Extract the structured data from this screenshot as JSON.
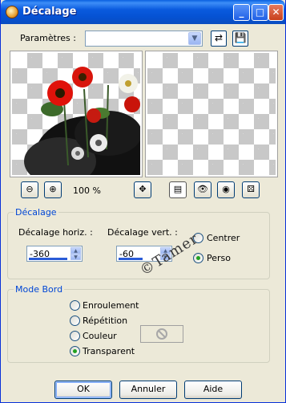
{
  "window": {
    "title": "Décalage"
  },
  "presets": {
    "label": "Paramètres :",
    "value": ""
  },
  "zoom": {
    "level_text": "100 %"
  },
  "offset_group": {
    "title": "Décalage",
    "horiz_label": "Décalage horiz. :",
    "horiz_value": "-360",
    "vert_label": "Décalage vert. :",
    "vert_value": "-60",
    "option_center": "Centrer",
    "option_custom": "Perso",
    "selected": "Perso"
  },
  "edge_group": {
    "title": "Mode Bord",
    "options": [
      "Enroulement",
      "Répétition",
      "Couleur",
      "Transparent"
    ],
    "selected": "Transparent"
  },
  "watermark_text": "©Tamer",
  "buttons": {
    "ok": "OK",
    "cancel": "Annuler",
    "help": "Aide"
  }
}
